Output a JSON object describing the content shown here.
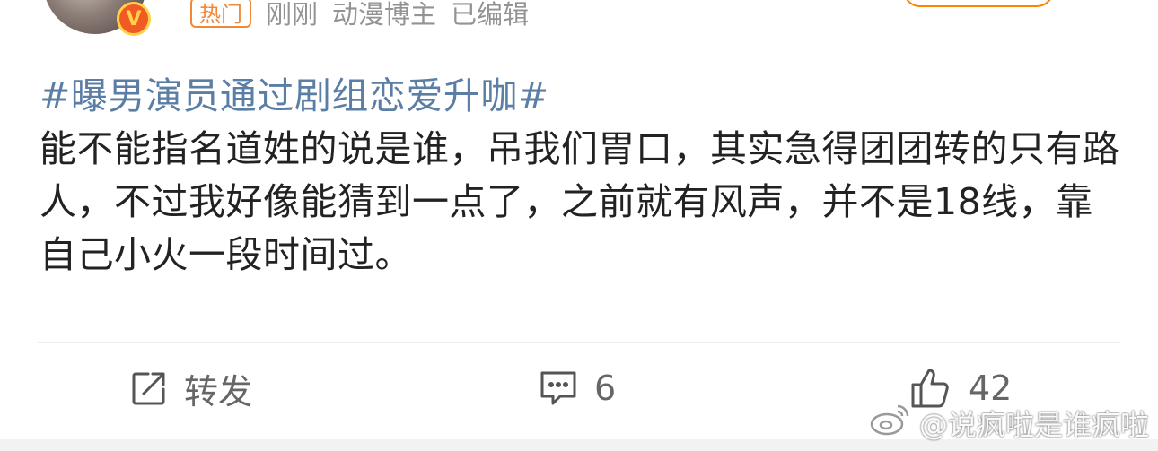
{
  "post": {
    "hot_badge": "热门",
    "time": "刚刚",
    "author_tag": "动漫博主",
    "edited": "已编辑",
    "verified_mark": "V",
    "hashtag": "#曝男演员通过剧组恋爱升咖#",
    "body": "能不能指名道姓的说是谁，吊我们胃口，其实急得团团转的只有路人，不过我好像能猜到一点了，之前就有风声，并不是18线，靠自己小火一段时间过。"
  },
  "actions": {
    "repost_label": "转发",
    "comment_count": "6",
    "like_count": "42"
  },
  "watermark": {
    "text": "@说疯啦是谁疯啦"
  },
  "icons": {
    "repost": "repost-icon",
    "comment": "comment-icon",
    "like": "thumbs-up-icon",
    "weibo": "weibo-logo-icon"
  },
  "colors": {
    "hashtag": "#5b7ea4",
    "hot": "#f0883a",
    "meta": "#939393",
    "follow_border": "#ff8200"
  }
}
